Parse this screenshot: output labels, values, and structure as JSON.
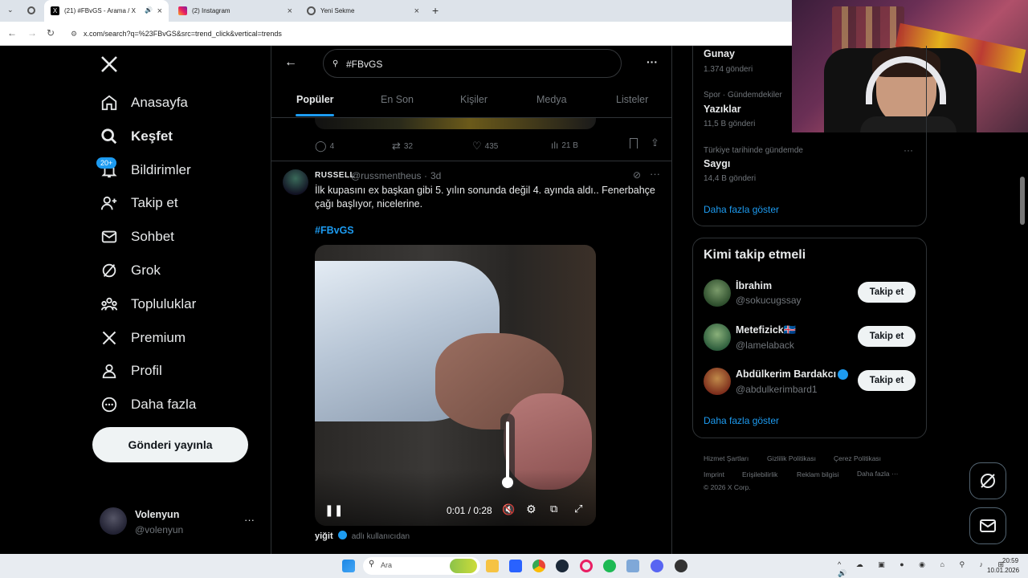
{
  "browser": {
    "tabs": [
      {
        "title": "(21) #FBvGS - Arama / X",
        "active": true
      },
      {
        "title": "(2) Instagram",
        "active": false
      },
      {
        "title": "Yeni Sekme",
        "active": false
      }
    ],
    "new_tab": "+",
    "url": "x.com/search?q=%23FBvGS&src=trend_click&vertical=trends"
  },
  "sidebar": {
    "items": [
      {
        "label": "Anasayfa",
        "icon": "home-icon"
      },
      {
        "label": "Keşfet",
        "icon": "search-icon"
      },
      {
        "label": "Bildirimler",
        "icon": "bell-icon"
      },
      {
        "label": "Takip et",
        "icon": "person-plus-icon"
      },
      {
        "label": "Sohbet",
        "icon": "envelope-icon"
      },
      {
        "label": "Grok",
        "icon": "grok-icon"
      },
      {
        "label": "Topluluklar",
        "icon": "people-icon"
      },
      {
        "label": "Premium",
        "icon": "x-logo-icon"
      },
      {
        "label": "Profil",
        "icon": "person-icon"
      },
      {
        "label": "Daha fazla",
        "icon": "more-circle-icon"
      }
    ],
    "notif_badge": "20+",
    "post_button": "Gönderi yayınla",
    "account": {
      "name": "Volenyun",
      "handle": "@volenyun",
      "more": "···"
    }
  },
  "main": {
    "search_value": "#FBvGS",
    "more": "···",
    "tabs": [
      "Popüler",
      "En Son",
      "Kişiler",
      "Medya",
      "Listeler"
    ],
    "prev_post": {
      "replies": "4",
      "reposts": "32",
      "likes": "435",
      "views": "21 B"
    },
    "post": {
      "author_name": "RUSSELL",
      "handle": "@russmentheus",
      "separator": "·",
      "age": "3d",
      "text": "İlk kupasını ex başkan gibi 5. yılın sonunda değil 4. ayında aldı.. Fenerbahçe çağı başlıyor, nicelerine.",
      "hashtag": "#FBvGS",
      "video_time": "0:01 / 0:28"
    },
    "next_post": {
      "author": "yiğit",
      "note": "adlı kullanıcıdan"
    }
  },
  "right": {
    "trends": [
      {
        "category": "",
        "name": "Gunay",
        "count": "1.374 gönderi"
      },
      {
        "category": "Spor · Gündemdekiler",
        "name": "Yazıklar",
        "count": "11,5 B gönderi"
      },
      {
        "category": "Türkiye tarihinde gündemde",
        "name": "Saygı",
        "count": "14,4 B gönderi"
      }
    ],
    "trends_more": "Daha fazla göster",
    "trend_more_dots": "···",
    "who_to_follow": {
      "title": "Kimi takip etmeli",
      "users": [
        {
          "name": "İbrahim",
          "handle": "@sokucugssay",
          "button": "Takip et"
        },
        {
          "name": "Metefizick🇮🇸",
          "handle": "@lamelaback",
          "button": "Takip et"
        },
        {
          "name": "Abdülkerim Bardakcı",
          "handle": "@abdulkerimbard1",
          "button": "Takip et"
        }
      ],
      "more": "Daha fazla göster"
    },
    "footer": {
      "links": [
        "Hizmet Şartları",
        "Gizlilik Politikası",
        "Çerez Politikası",
        "Imprint",
        "Erişilebilirlik",
        "Reklam bilgisi",
        "Daha fazla ···"
      ],
      "copyright": "© 2026 X Corp."
    }
  },
  "taskbar": {
    "search_placeholder": "Ara",
    "time": "20:59",
    "date": "10.01.2026"
  }
}
